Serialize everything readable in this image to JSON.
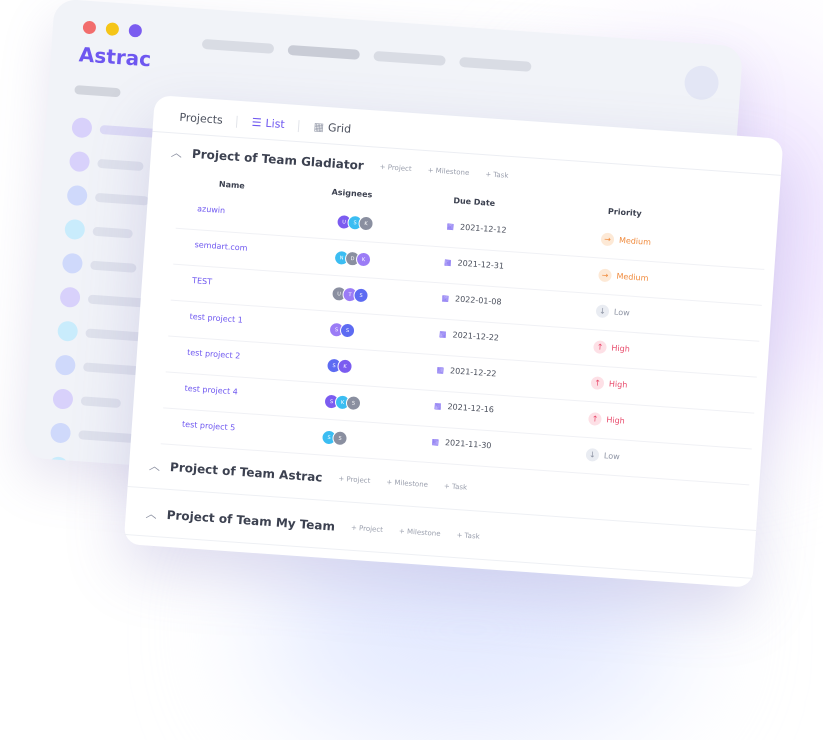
{
  "app": {
    "name": "Astrac",
    "window_dot_colors": [
      "#f26d6d",
      "#f5c518",
      "#7b5cf0"
    ]
  },
  "tabs": {
    "projects_label": "Projects",
    "list_label": "List",
    "grid_label": "Grid"
  },
  "table": {
    "headers": {
      "name": "Name",
      "assignees": "Asignees",
      "due": "Due Date",
      "priority": "Priority"
    }
  },
  "groups": [
    {
      "title": "Project of Team Gladiator",
      "actions": [
        "+ Project",
        "+ Milestone",
        "+ Task"
      ],
      "rows": [
        {
          "name": "azuwin",
          "assignees": [
            "U",
            "S",
            "K"
          ],
          "due": "2021-12-12",
          "priority": "Medium"
        },
        {
          "name": "semdart.com",
          "assignees": [
            "N",
            "D",
            "K"
          ],
          "due": "2021-12-31",
          "priority": "Medium"
        },
        {
          "name": "TEST",
          "assignees": [
            "U",
            "T",
            "S"
          ],
          "due": "2022-01-08",
          "priority": "Low"
        },
        {
          "name": "test project 1",
          "assignees": [
            "S",
            "S"
          ],
          "due": "2021-12-22",
          "priority": "High"
        },
        {
          "name": "test project 2",
          "assignees": [
            "S",
            "K"
          ],
          "due": "2021-12-22",
          "priority": "High"
        },
        {
          "name": "test project 4",
          "assignees": [
            "S",
            "K",
            "S"
          ],
          "due": "2021-12-16",
          "priority": "High"
        },
        {
          "name": "test project 5",
          "assignees": [
            "S",
            "S"
          ],
          "due": "2021-11-30",
          "priority": "Low"
        }
      ]
    },
    {
      "title": "Project of Team Astrac",
      "actions": [
        "+ Project",
        "+ Milestone",
        "+ Task"
      ],
      "rows": []
    },
    {
      "title": "Project of Team My Team",
      "actions": [
        "+ Project",
        "+ Milestone",
        "+ Task"
      ],
      "rows": []
    }
  ],
  "colors": {
    "accent": "#6e57f0",
    "medium": "#f08a3c",
    "medium_bg": "#fde9d6",
    "high": "#e8496a",
    "high_bg": "#fde0e6",
    "low": "#8d93a3",
    "low_bg": "#e9ecf2"
  },
  "icons": {
    "list": "list-icon",
    "grid": "grid-icon",
    "calendar": "calendar-icon",
    "chevron": "chevron-up-icon"
  }
}
